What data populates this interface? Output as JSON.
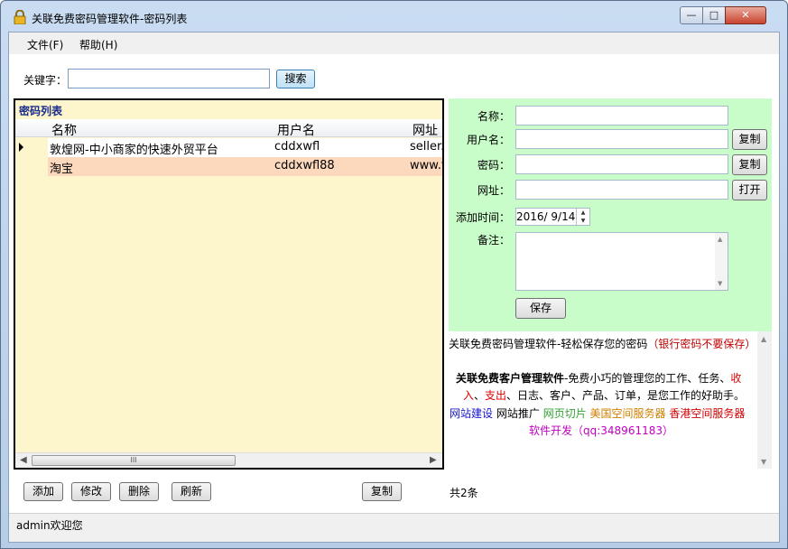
{
  "window": {
    "title": "关联免费密码管理软件-密码列表"
  },
  "menu": {
    "file": "文件(F)",
    "help": "帮助(H)"
  },
  "search": {
    "label": "关键字：",
    "value": "",
    "button": "搜索"
  },
  "list": {
    "caption": "密码列表",
    "columns": [
      "名称",
      "用户名",
      "网址"
    ],
    "rows": [
      {
        "name": "敦煌网-中小商家的快速外贸平台",
        "user": "cddxwfl",
        "url": "seller.d"
      },
      {
        "name": "淘宝",
        "user": "cddxwfl88",
        "url": "www.ta"
      }
    ],
    "scrollbar_thumb": "III"
  },
  "form": {
    "name_label": "名称：",
    "user_label": "用户名：",
    "password_label": "密码：",
    "url_label": "网址：",
    "date_label": "添加时间：",
    "note_label": "备注：",
    "name_value": "",
    "user_value": "",
    "password_value": "",
    "url_value": "",
    "date_value": "2016/  9/14",
    "note_value": "",
    "copy_user_btn": "复制",
    "copy_pwd_btn": "复制",
    "open_btn": "打开",
    "save_btn": "保存"
  },
  "info": {
    "line1_a": "关联免费密码管理软件-轻松保存您的密码",
    "line1_b": "（银行密码不要保存）",
    "line2_a": "关联免费客户管理软件",
    "line2_b": "-免费小巧的管理您的工作、任务、",
    "line2_c": "收",
    "line3_a": "入",
    "line3_sep1": "、",
    "line3_b": "支出",
    "line3_c": "、日志、客户、产品、订单，是您工作的好助手。",
    "link_site": "网站建设",
    "link_promo": "网站推广",
    "link_slice": "网页切片",
    "link_us": "美国空间服务器",
    "link_hk": "香港空间服务器",
    "link_dev": "软件开发（qq:348961183）"
  },
  "actions": {
    "add": "添加",
    "edit": "修改",
    "delete": "删除",
    "refresh": "刷新",
    "copy": "复制",
    "count": "共2条"
  },
  "status": {
    "text": "admin欢迎您"
  },
  "colors": {
    "list_bg": "#fdf5cc",
    "selected_row": "#fcd9bc",
    "form_bg": "#c8fcc8"
  }
}
